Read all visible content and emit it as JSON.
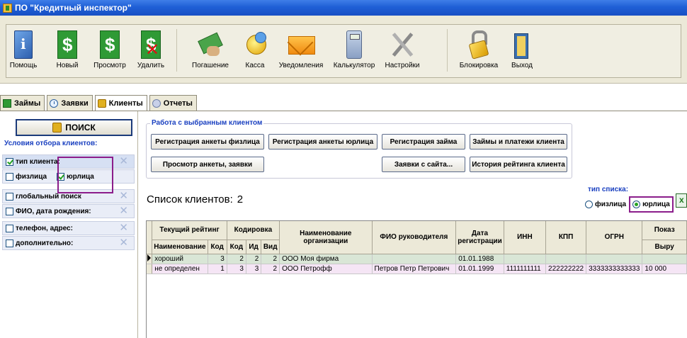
{
  "window": {
    "title": "ПО \"Кредитный инспектор\""
  },
  "toolbar": {
    "buttons": [
      {
        "label": "Помощь",
        "icon": "help-book-icon"
      },
      {
        "label": "Новый",
        "icon": "dollar-new-icon"
      },
      {
        "label": "Просмотр",
        "icon": "dollar-view-icon"
      },
      {
        "label": "Удалить",
        "icon": "dollar-delete-icon"
      },
      {
        "label": "Погашение",
        "icon": "money-payment-icon"
      },
      {
        "label": "Касса",
        "icon": "coins-icon"
      },
      {
        "label": "Уведомления",
        "icon": "envelope-icon"
      },
      {
        "label": "Калькулятор",
        "icon": "calculator-icon"
      },
      {
        "label": "Настройки",
        "icon": "tools-icon"
      },
      {
        "label": "Блокировка",
        "icon": "padlock-icon"
      },
      {
        "label": "Выход",
        "icon": "door-exit-icon"
      }
    ]
  },
  "tabs": [
    {
      "label": "Займы",
      "icon": "money-icon"
    },
    {
      "label": "Заявки",
      "icon": "clock-icon"
    },
    {
      "label": "Клиенты",
      "icon": "lock-icon",
      "active": true
    },
    {
      "label": "Отчеты",
      "icon": "report-icon"
    }
  ],
  "left": {
    "search_label": "ПОИСК",
    "filter_title": "Условия отбора клиентов:",
    "filters": [
      {
        "label": "тип клиента:",
        "checked": true
      },
      {
        "label": "глобальный поиск",
        "checked": false
      },
      {
        "label": "ФИО, дата рождения:",
        "checked": false
      },
      {
        "label": "телефон, адрес:",
        "checked": false
      },
      {
        "label": "дополнительно:",
        "checked": false
      }
    ],
    "client_type": {
      "fiz": "физлица",
      "yur": "юрлица"
    }
  },
  "actions": {
    "group_title": "Работа с выбранным клиентом",
    "reg_fiz": "Регистрация анкеты физлица",
    "reg_yur": "Регистрация анкеты юрлица",
    "reg_loan": "Регистрация займа",
    "loans_payments": "Займы и платежи клиента",
    "view_form": "Просмотр анкеты, заявки",
    "site_requests": "Заявки с сайта...",
    "rating_history": "История рейтинга клиента"
  },
  "list": {
    "title": "Список клиентов:",
    "count": "2",
    "type_title": "тип списка:",
    "type_fiz": "физлица",
    "type_yur": "юрлица"
  },
  "table": {
    "group_headers": {
      "rating": "Текущий рейтинг",
      "coding": "Кодировка",
      "org": "Наименование организации",
      "head": "ФИО руководителя",
      "regdate": "Дата регистрации",
      "inn": "ИНН",
      "kpp": "КПП",
      "ogrn": "ОГРН",
      "indicators": "Показ"
    },
    "sub_headers": {
      "name": "Наименование",
      "code": "Код",
      "kod": "Код",
      "id": "Ид",
      "vid": "Вид",
      "revenue": "Выру"
    },
    "rows": [
      {
        "rating": "хороший",
        "code": "3",
        "kod": "2",
        "id": "2",
        "vid": "2",
        "org": "ООО Моя фирма",
        "head": "",
        "date": "01.01.1988",
        "inn": "",
        "kpp": "",
        "ogrn": "",
        "rev": ""
      },
      {
        "rating": "не определен",
        "code": "1",
        "kod": "3",
        "id": "3",
        "vid": "2",
        "org": "ООО Петрофф",
        "head": "Петров Петр Петрович",
        "date": "01.01.1999",
        "inn": "1111111111",
        "kpp": "222222222",
        "ogrn": "3333333333333",
        "rev": "10 000"
      }
    ]
  }
}
